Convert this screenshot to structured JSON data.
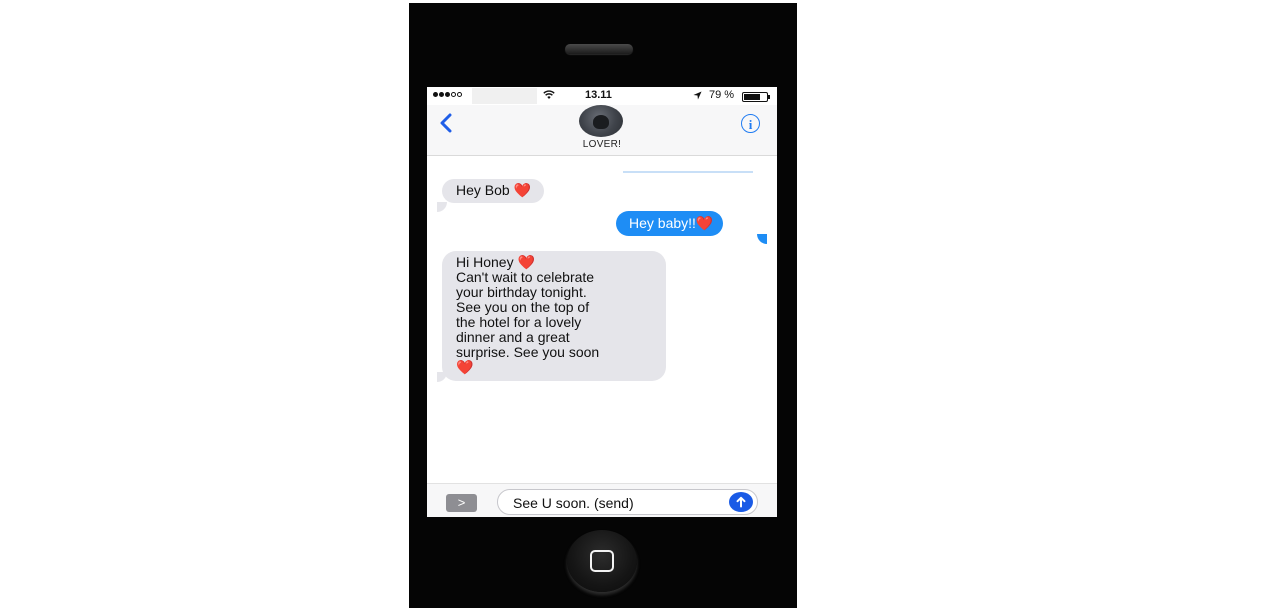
{
  "status_bar": {
    "time": "13.11",
    "battery_percent": "79 %",
    "battery_level": 0.79,
    "signal_bars_filled": 3,
    "signal_bars_total": 5
  },
  "header": {
    "back_icon": "chevron-left-icon",
    "contact_name": "LOVER!",
    "info_icon": "info-icon",
    "info_glyph": "i"
  },
  "messages": [
    {
      "direction": "incoming",
      "text": "Hey Bob ❤️"
    },
    {
      "direction": "outgoing",
      "text": "Hey baby!!❤️"
    },
    {
      "direction": "incoming",
      "text": "Hi Honey ❤️\nCan't wait to celebrate\nyour birthday tonight.\nSee you on the top of\nthe hotel for a lovely\ndinner and a great\nsurprise. See you soon\n❤️"
    }
  ],
  "composer": {
    "expand_glyph": ">",
    "draft_text": "See U soon. (send)",
    "send_icon": "arrow-up-icon"
  },
  "colors": {
    "incoming_bubble": "#e5e5ea",
    "outgoing_bubble": "#1e8df5",
    "accent": "#1f7bf2",
    "send_button": "#1a5be6"
  }
}
